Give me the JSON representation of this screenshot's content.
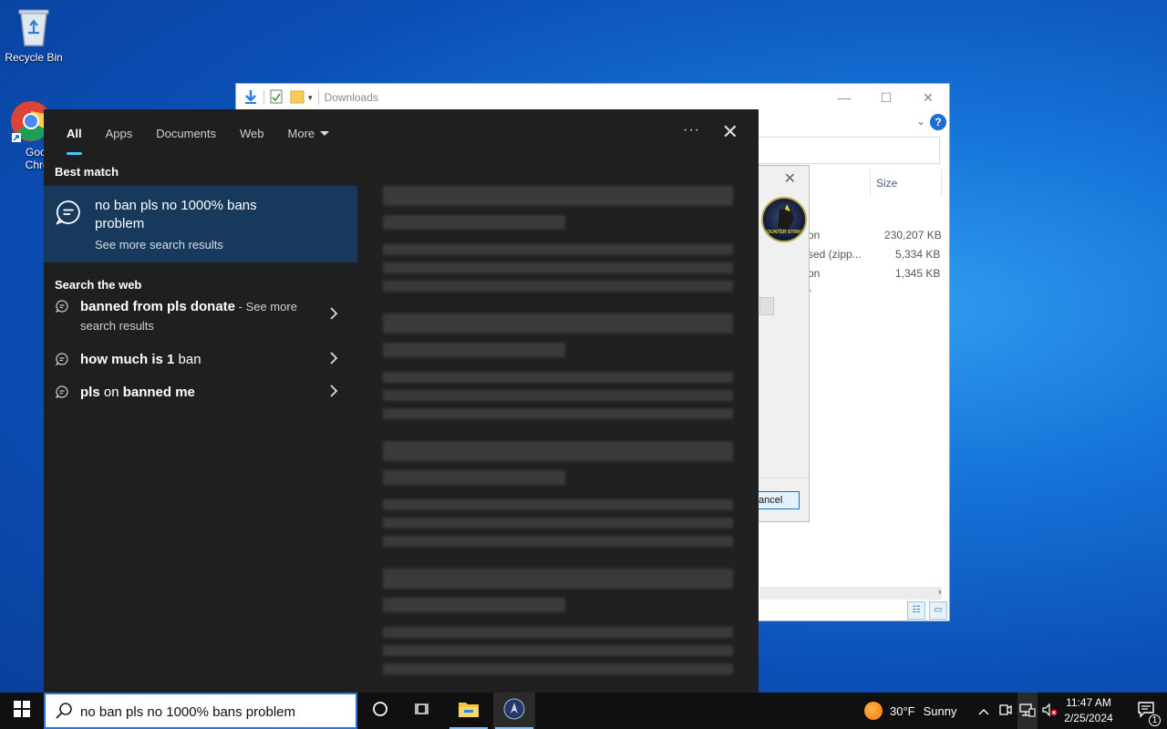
{
  "desktop": {
    "recycle_bin_label": "Recycle Bin",
    "chrome_label_line1": "Googl",
    "chrome_label_line2": "Chron"
  },
  "explorer": {
    "title": "Downloads",
    "col_size": "Size",
    "rows": [
      {
        "type": "on",
        "size": "230,207 KB"
      },
      {
        "type": "sed (zipp...",
        "size": "5,334 KB"
      },
      {
        "type": "on",
        "size": "1,345 KB"
      },
      {
        "type": "r",
        "size": ""
      }
    ]
  },
  "dialog": {
    "logo_text": "COUNTER STRIKE",
    "cancel_label": "ancel"
  },
  "search": {
    "tabs": [
      {
        "label": "All",
        "active": true
      },
      {
        "label": "Apps"
      },
      {
        "label": "Documents"
      },
      {
        "label": "Web"
      },
      {
        "label": "More"
      }
    ],
    "dots": "···",
    "best_match_title": "Best match",
    "best_match": {
      "title": "no ban pls no 1000% bans problem",
      "see_more": "See more search results"
    },
    "web_title": "Search the web",
    "web_results": [
      {
        "bold": "banned from pls donate",
        "plain": " - See more search results"
      },
      {
        "bold": "how much is 1",
        "plain": " ban"
      },
      {
        "bold_pre": "pls",
        "plain": " on",
        "bold": " banned me"
      }
    ]
  },
  "taskbar": {
    "search_value": "no ban pls no 1000% bans problem",
    "weather_temp": "30°F",
    "weather_text": "Sunny",
    "time": "11:47 AM",
    "date": "2/25/2024",
    "notification_count": "1"
  },
  "colors": {
    "accent": "#4cc2ff",
    "best_match_bg": "#17395b",
    "panel_bg": "#1f1f1f"
  }
}
